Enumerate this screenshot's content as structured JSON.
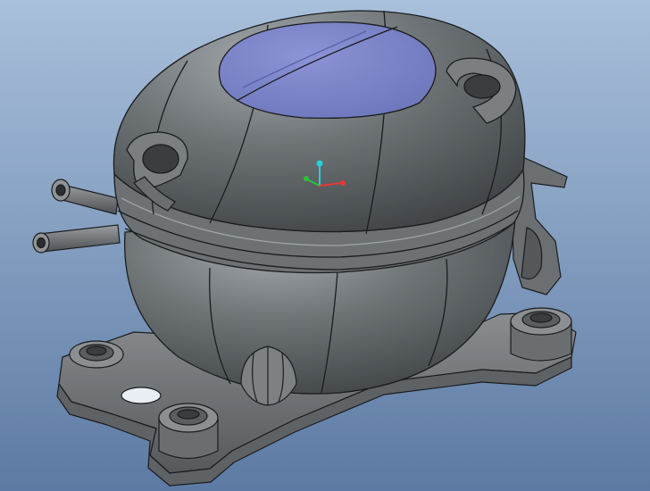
{
  "viewport": {
    "background_top": "#a9c0db",
    "background_bottom": "#5c7aa3"
  },
  "model": {
    "body_color": "#6e7275",
    "body_shadow": "#4a4e51",
    "highlight_color": "#b9bfc3",
    "edge_color": "#1b1c1e",
    "selected_face_color": "#7b86c9",
    "objects": [
      "compressor-shell",
      "top-cap-face",
      "mounting-base",
      "suction-tube",
      "discharge-tube",
      "terminal-boss",
      "lifting-lug-left",
      "lifting-lug-right"
    ]
  },
  "triad": {
    "x_color": "#e53935",
    "y_color": "#2fbf3a",
    "z_color": "#25d0d8"
  }
}
